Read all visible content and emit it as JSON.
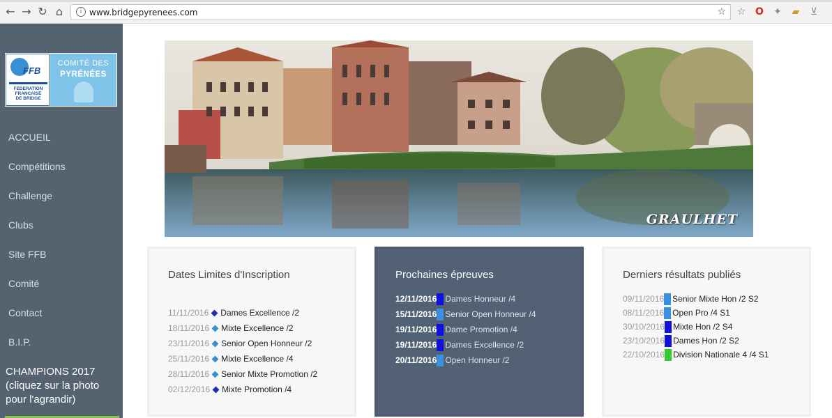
{
  "browser": {
    "url": "www.bridgepyrenees.com",
    "nav_icons": [
      "back-arrow-icon",
      "forward-arrow-icon",
      "reload-icon",
      "home-icon"
    ],
    "extension_icons": [
      "star-outline-icon",
      "opera-icon",
      "puzzle-extension-icon",
      "folder-extension-icon",
      "inbox-extension-icon"
    ]
  },
  "logo": {
    "ffb_mark": "FFB",
    "ffb_lines": [
      "FEDERATION",
      "FRANCAISE",
      "DE BRIDGE"
    ],
    "comite_top": "COMITÉ DES",
    "comite_main": "PYRÉNÉES"
  },
  "sidebar": {
    "items": [
      {
        "label": "ACCUEIL"
      },
      {
        "label": "Compétitions"
      },
      {
        "label": "Challenge"
      },
      {
        "label": "Clubs"
      },
      {
        "label": "Site FFB"
      },
      {
        "label": "Comité"
      },
      {
        "label": "Contact"
      },
      {
        "label": "B.I.P."
      }
    ],
    "champions_line1": "CHAMPIONS 2017",
    "champions_line2": "(cliquez sur la photo",
    "champions_line3": "pour l'agrandir)",
    "accent": "#8bc34a"
  },
  "banner": {
    "caption": "GRAULHET"
  },
  "dates_limites": {
    "title": "Dates Limites d'Inscription",
    "rows": [
      {
        "date": "11/11/2016",
        "label": "Dames Excellence /2",
        "marker": "#1f2fb0"
      },
      {
        "date": "18/11/2016",
        "label": "Mixte Excellence /2",
        "marker": "#3a8fd1"
      },
      {
        "date": "23/11/2016",
        "label": "Senior Open Honneur /2",
        "marker": "#3a8fd1"
      },
      {
        "date": "25/11/2016",
        "label": "Mixte Excellence /4",
        "marker": "#3a8fd1"
      },
      {
        "date": "28/11/2016",
        "label": "Senior Mixte Promotion /2",
        "marker": "#3a8fd1"
      },
      {
        "date": "02/12/2016",
        "label": "Mixte Promotion /4",
        "marker": "#1f2fb0"
      }
    ]
  },
  "prochaines": {
    "title": "Prochaines épreuves",
    "rows": [
      {
        "date": "12/11/2016",
        "label": "Dames Honneur /4",
        "marker": "#1010e0"
      },
      {
        "date": "15/11/2016",
        "label": "Senior Open Honneur /4",
        "marker": "#3a8fe0"
      },
      {
        "date": "19/11/2016",
        "label": "Dame Promotion /4",
        "marker": "#1010e0"
      },
      {
        "date": "19/11/2016",
        "label": "Dames Excellence /2",
        "marker": "#1010e0"
      },
      {
        "date": "20/11/2016",
        "label": "Open Honneur /2",
        "marker": "#3a8fe0"
      }
    ]
  },
  "resultats": {
    "title": "Derniers résultats publiés",
    "rows": [
      {
        "date": "09/11/2016",
        "label": "Senior Mixte Hon /2 S2",
        "marker": "#3a8fe0"
      },
      {
        "date": "08/11/2016",
        "label": "Open Pro /4 S1",
        "marker": "#3a8fe0"
      },
      {
        "date": "30/10/2016",
        "label": "Mixte Hon /2 S4",
        "marker": "#1010e0"
      },
      {
        "date": "23/10/2016",
        "label": "Dames Hon /2 S2",
        "marker": "#1010e0"
      },
      {
        "date": "22/10/2016",
        "label": "Division Nationale 4 /4 S1",
        "marker": "#33cc33"
      }
    ]
  }
}
